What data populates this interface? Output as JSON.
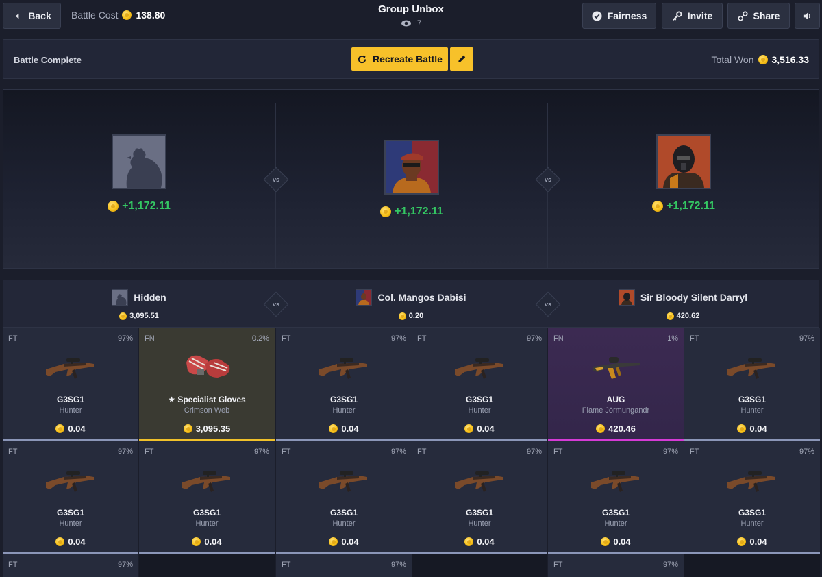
{
  "topbar": {
    "back_label": "Back",
    "battle_cost_label": "Battle Cost",
    "battle_cost_value": "138.80",
    "title": "Group Unbox",
    "viewers": "7",
    "fairness_label": "Fairness",
    "invite_label": "Invite",
    "share_label": "Share"
  },
  "status": {
    "text": "Battle Complete",
    "recreate_label": "Recreate Battle",
    "total_won_label": "Total Won",
    "total_won_value": "3,516.33"
  },
  "arena": {
    "vs": "vs",
    "players": [
      {
        "avatar": "chicken-silhouette",
        "winnings": "+1,172.11"
      },
      {
        "avatar": "soldier-beret",
        "winnings": "+1,172.11"
      },
      {
        "avatar": "masked-soldier",
        "winnings": "+1,172.11"
      }
    ]
  },
  "players": [
    {
      "name": "Hidden",
      "total": "3,095.51"
    },
    {
      "name": "Col. Mangos Dabisi",
      "total": "0.20"
    },
    {
      "name": "Sir Bloody Silent Darryl",
      "total": "420.62"
    }
  ],
  "cards": [
    {
      "cond": "FT",
      "odds": "97%",
      "name": "G3SG1",
      "skin": "Hunter",
      "price": "0.04"
    },
    {
      "cond": "FN",
      "odds": "0.2%",
      "name": "★ Specialist Gloves",
      "skin": "Crimson Web",
      "price": "3,095.35"
    },
    {
      "cond": "FT",
      "odds": "97%",
      "name": "G3SG1",
      "skin": "Hunter",
      "price": "0.04"
    },
    {
      "cond": "FT",
      "odds": "97%",
      "name": "G3SG1",
      "skin": "Hunter",
      "price": "0.04"
    },
    {
      "cond": "FN",
      "odds": "1%",
      "name": "AUG",
      "skin": "Flame Jörmungandr",
      "price": "420.46"
    },
    {
      "cond": "FT",
      "odds": "97%",
      "name": "G3SG1",
      "skin": "Hunter",
      "price": "0.04"
    },
    {
      "cond": "FT",
      "odds": "97%",
      "name": "G3SG1",
      "skin": "Hunter",
      "price": "0.04"
    },
    {
      "cond": "FT",
      "odds": "97%",
      "name": "G3SG1",
      "skin": "Hunter",
      "price": "0.04"
    },
    {
      "cond": "FT",
      "odds": "97%",
      "name": "G3SG1",
      "skin": "Hunter",
      "price": "0.04"
    },
    {
      "cond": "FT",
      "odds": "97%",
      "name": "G3SG1",
      "skin": "Hunter",
      "price": "0.04"
    },
    {
      "cond": "FT",
      "odds": "97%",
      "name": "G3SG1",
      "skin": "Hunter",
      "price": "0.04"
    },
    {
      "cond": "FT",
      "odds": "97%",
      "name": "G3SG1",
      "skin": "Hunter",
      "price": "0.04"
    },
    {
      "cond": "FT",
      "odds": "97%"
    },
    {
      "cond": "FT",
      "odds": "97%"
    },
    {
      "cond": "FT",
      "odds": "97%"
    }
  ],
  "colors": {
    "accent": "#f7c12a",
    "win": "#34c763",
    "rare_gold": "#f0c12a",
    "rare_purple": "#d53bd6"
  }
}
